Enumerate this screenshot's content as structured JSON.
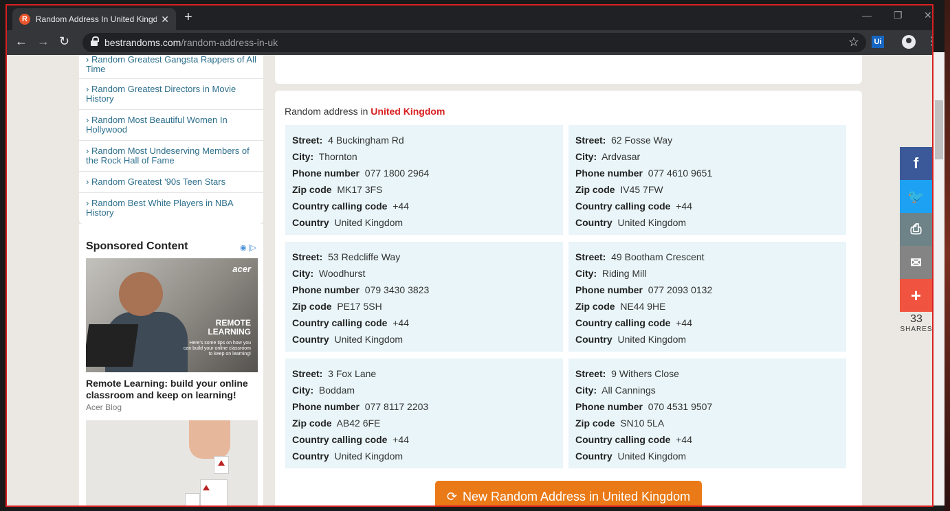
{
  "browser": {
    "tab_title": "Random Address In United Kingdo",
    "favicon_letter": "R",
    "close_glyph": "✕",
    "new_tab_glyph": "+",
    "url_host": "bestrandoms.com",
    "url_path": "/random-address-in-uk",
    "ext_label": "Ui"
  },
  "sidebar": {
    "links": [
      "› Random Greatest Gangsta Rappers of All Time",
      "› Random Greatest Directors in Movie History",
      "› Random Most Beautiful Women In Hollywood",
      "› Random Most Undeserving Members of the Rock Hall of Fame",
      "› Random Greatest '90s Teen Stars",
      "› Random Best White Players in NBA History"
    ],
    "sponsored_title": "Sponsored Content",
    "ad1": {
      "logo": "acer",
      "overlay_title_1": "REMOTE",
      "overlay_title_2": "LEARNING",
      "overlay_tips": "Here's some tips on how you can build your online classroom to keep on learning!",
      "headline": "Remote Learning: build your online classroom and keep on learning!",
      "source": "Acer Blog"
    }
  },
  "main": {
    "heading_prefix": "Random address in ",
    "heading_country": "United Kingdom",
    "labels": {
      "street": "Street:",
      "city": "City:",
      "phone": "Phone number",
      "zip": "Zip code",
      "calling": "Country calling code",
      "country": "Country"
    },
    "addresses": [
      {
        "street": "4 Buckingham Rd",
        "city": "Thornton",
        "phone": "077 1800 2964",
        "zip": "MK17 3FS",
        "calling": "+44",
        "country": "United Kingdom"
      },
      {
        "street": "62 Fosse Way",
        "city": "Ardvasar",
        "phone": "077 4610 9651",
        "zip": "IV45 7FW",
        "calling": "+44",
        "country": "United Kingdom"
      },
      {
        "street": "53 Redcliffe Way",
        "city": "Woodhurst",
        "phone": "079 3430 3823",
        "zip": "PE17 5SH",
        "calling": "+44",
        "country": "United Kingdom"
      },
      {
        "street": "49 Bootham Crescent",
        "city": "Riding Mill",
        "phone": "077 2093 0132",
        "zip": "NE44 9HE",
        "calling": "+44",
        "country": "United Kingdom"
      },
      {
        "street": "3 Fox Lane",
        "city": "Boddam",
        "phone": "077 8117 2203",
        "zip": "AB42 6FE",
        "calling": "+44",
        "country": "United Kingdom"
      },
      {
        "street": "9 Withers Close",
        "city": "All Cannings",
        "phone": "070 4531 9507",
        "zip": "SN10 5LA",
        "calling": "+44",
        "country": "United Kingdom"
      }
    ],
    "new_button": "New Random Address in United Kingdom"
  },
  "share": {
    "count": "33",
    "label": "SHARES",
    "colors": {
      "facebook": "#3b5998",
      "twitter": "#1da1f2",
      "print": "#6d8388",
      "email": "#848484",
      "more": "#f0533f"
    }
  }
}
